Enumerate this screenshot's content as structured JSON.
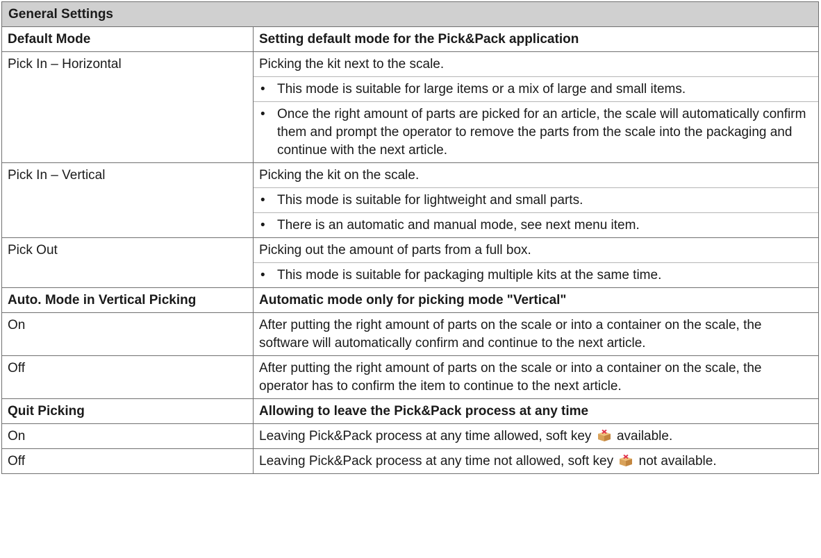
{
  "table": {
    "title": "General Settings",
    "sections": [
      {
        "header": {
          "key": "Default Mode",
          "desc": "Setting default mode for the Pick&Pack application"
        },
        "rows": [
          {
            "key": "Pick In – Horizontal",
            "intro": "Picking the kit next to the scale.",
            "bullets": [
              "This mode is suitable for large items or a mix of large and small items.",
              "Once the right amount of parts are picked for an article, the scale will automatically confirm them and prompt the operator to remove the parts from the scale into the packaging and continue with the next article."
            ]
          },
          {
            "key": "Pick In – Vertical",
            "intro": "Picking the kit on the scale.",
            "bullets": [
              "This mode is suitable for lightweight and small parts.",
              "There is an automatic and manual mode, see next menu item."
            ]
          },
          {
            "key": "Pick Out",
            "intro": "Picking out the amount of parts from a full box.",
            "bullets": [
              "This mode is suitable for packaging multiple kits at the same time."
            ]
          }
        ]
      },
      {
        "header": {
          "key": "Auto. Mode in Vertical Picking",
          "desc": "Automatic mode only for picking mode \"Vertical\""
        },
        "rows": [
          {
            "key": "On",
            "text": "After putting the right amount of parts on the scale or into a container on the scale, the software will automatically confirm and continue to the next article."
          },
          {
            "key": "Off",
            "text": "After putting the right amount of parts on the scale or into a container on the scale, the operator has to confirm the item to continue to the next article."
          }
        ]
      },
      {
        "header": {
          "key": "Quit Picking",
          "desc": "Allowing to leave the Pick&Pack process at any time"
        },
        "rows": [
          {
            "key": "On",
            "text_before": "Leaving Pick&Pack process at any time allowed, soft key",
            "text_after": "available.",
            "icon": "quit-box-icon"
          },
          {
            "key": "Off",
            "text_before": "Leaving Pick&Pack process at any time not allowed, soft key",
            "text_after": "not available.",
            "icon": "quit-box-icon"
          }
        ]
      }
    ]
  },
  "bullet_char": "•",
  "colors": {
    "title_bg": "#d0d0d0",
    "border": "#6f6f6f",
    "icon_box": "#d9a25a",
    "icon_x": "#e0304a"
  }
}
